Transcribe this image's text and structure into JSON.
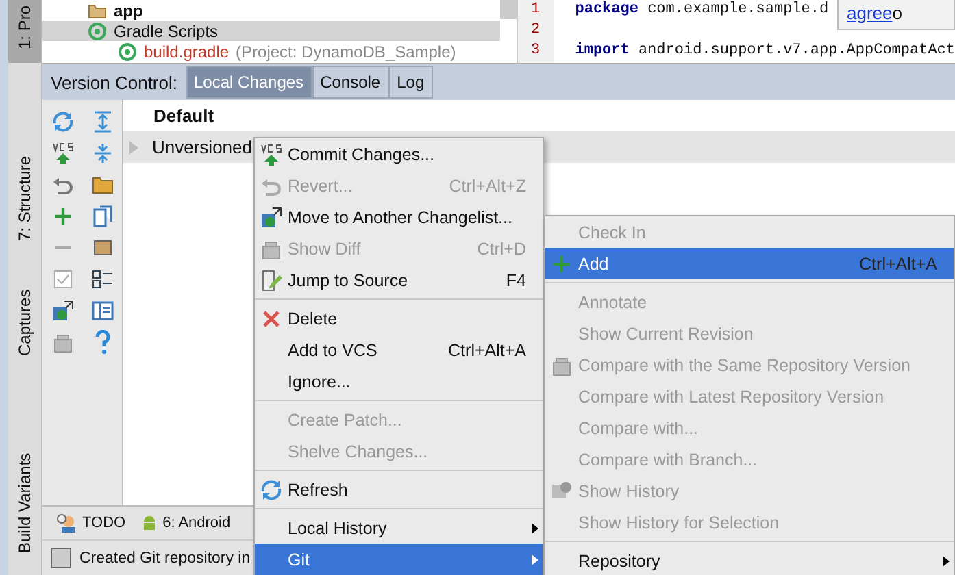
{
  "side_stripe": [
    {
      "label": "1: Pro",
      "selected": true
    },
    {
      "label": "7: Structure",
      "selected": false
    },
    {
      "label": "Captures",
      "selected": false
    },
    {
      "label": "Build Variants",
      "selected": false
    }
  ],
  "project_tree": [
    {
      "label": "app",
      "selected": false
    },
    {
      "label": "Gradle Scripts",
      "selected": true
    },
    {
      "label": "build.gradle",
      "detail": "(Project: DynamoDB_Sample)",
      "selected": false
    }
  ],
  "editor": {
    "lines": [
      {
        "number": "1",
        "keyword": "package",
        "code": " com.example.sample.d"
      },
      {
        "number": "2"
      },
      {
        "number": "3",
        "keyword": "import",
        "code": " android.support.v7.app.AppCompatAct"
      }
    ],
    "notice": {
      "link": "agree",
      "text": " o"
    }
  },
  "tool_window": {
    "title": "Version Control:",
    "tabs": [
      {
        "label": "Local Changes",
        "selected": true
      },
      {
        "label": "Console",
        "selected": false
      },
      {
        "label": "Log",
        "selected": false
      }
    ],
    "changes": [
      {
        "label": "Default",
        "bold": true
      },
      {
        "label": "Unversioned",
        "bold": false
      }
    ]
  },
  "context_menu": [
    {
      "kind": "item",
      "label": "Commit Changes...",
      "disabled": false,
      "submenu": false,
      "selected": false
    },
    {
      "kind": "item",
      "label": "Revert...",
      "shortcut": "Ctrl+Alt+Z",
      "disabled": true,
      "submenu": false,
      "selected": false
    },
    {
      "kind": "item",
      "label": "Move to Another Changelist...",
      "disabled": false,
      "submenu": false,
      "selected": false
    },
    {
      "kind": "item",
      "label": "Show Diff",
      "shortcut": "Ctrl+D",
      "disabled": true,
      "submenu": false,
      "selected": false
    },
    {
      "kind": "item",
      "label": "Jump to Source",
      "shortcut": "F4",
      "disabled": false,
      "submenu": false,
      "selected": false
    },
    {
      "kind": "separator"
    },
    {
      "kind": "item",
      "label": "Delete",
      "disabled": false,
      "submenu": false,
      "selected": false
    },
    {
      "kind": "item",
      "label": "Add to VCS",
      "shortcut": "Ctrl+Alt+A",
      "disabled": false,
      "submenu": false,
      "selected": false
    },
    {
      "kind": "item",
      "label": "Ignore...",
      "disabled": false,
      "submenu": false,
      "selected": false
    },
    {
      "kind": "separator"
    },
    {
      "kind": "item",
      "label": "Create Patch...",
      "disabled": true,
      "submenu": false,
      "selected": false
    },
    {
      "kind": "item",
      "label": "Shelve Changes...",
      "disabled": true,
      "submenu": false,
      "selected": false
    },
    {
      "kind": "separator"
    },
    {
      "kind": "item",
      "label": "Refresh",
      "disabled": false,
      "submenu": false,
      "selected": false
    },
    {
      "kind": "separator"
    },
    {
      "kind": "item",
      "label": "Local History",
      "disabled": false,
      "submenu": true,
      "selected": false
    },
    {
      "kind": "item",
      "label": "Git",
      "disabled": false,
      "submenu": true,
      "selected": true
    }
  ],
  "git_submenu": [
    {
      "kind": "item",
      "label": "Check In",
      "disabled": true,
      "submenu": false,
      "selected": false
    },
    {
      "kind": "item",
      "label": "Add",
      "shortcut": "Ctrl+Alt+A",
      "disabled": false,
      "submenu": false,
      "selected": true
    },
    {
      "kind": "separator"
    },
    {
      "kind": "item",
      "label": "Annotate",
      "disabled": true,
      "submenu": false,
      "selected": false
    },
    {
      "kind": "item",
      "label": "Show Current Revision",
      "disabled": true,
      "submenu": false,
      "selected": false
    },
    {
      "kind": "item",
      "label": "Compare with the Same Repository Version",
      "disabled": true,
      "submenu": false,
      "selected": false
    },
    {
      "kind": "item",
      "label": "Compare with Latest Repository Version",
      "disabled": true,
      "submenu": false,
      "selected": false
    },
    {
      "kind": "item",
      "label": "Compare with...",
      "disabled": true,
      "submenu": false,
      "selected": false
    },
    {
      "kind": "item",
      "label": "Compare with Branch...",
      "disabled": true,
      "submenu": false,
      "selected": false
    },
    {
      "kind": "item",
      "label": "Show History",
      "disabled": true,
      "submenu": false,
      "selected": false
    },
    {
      "kind": "item",
      "label": "Show History for Selection",
      "disabled": true,
      "submenu": false,
      "selected": false
    },
    {
      "kind": "separator"
    },
    {
      "kind": "item",
      "label": "Repository",
      "disabled": false,
      "submenu": true,
      "selected": false
    }
  ],
  "bottom_tools": [
    {
      "label": "TODO"
    },
    {
      "label": "6: Android"
    }
  ],
  "status_bar": {
    "message": "Created Git repository in"
  }
}
